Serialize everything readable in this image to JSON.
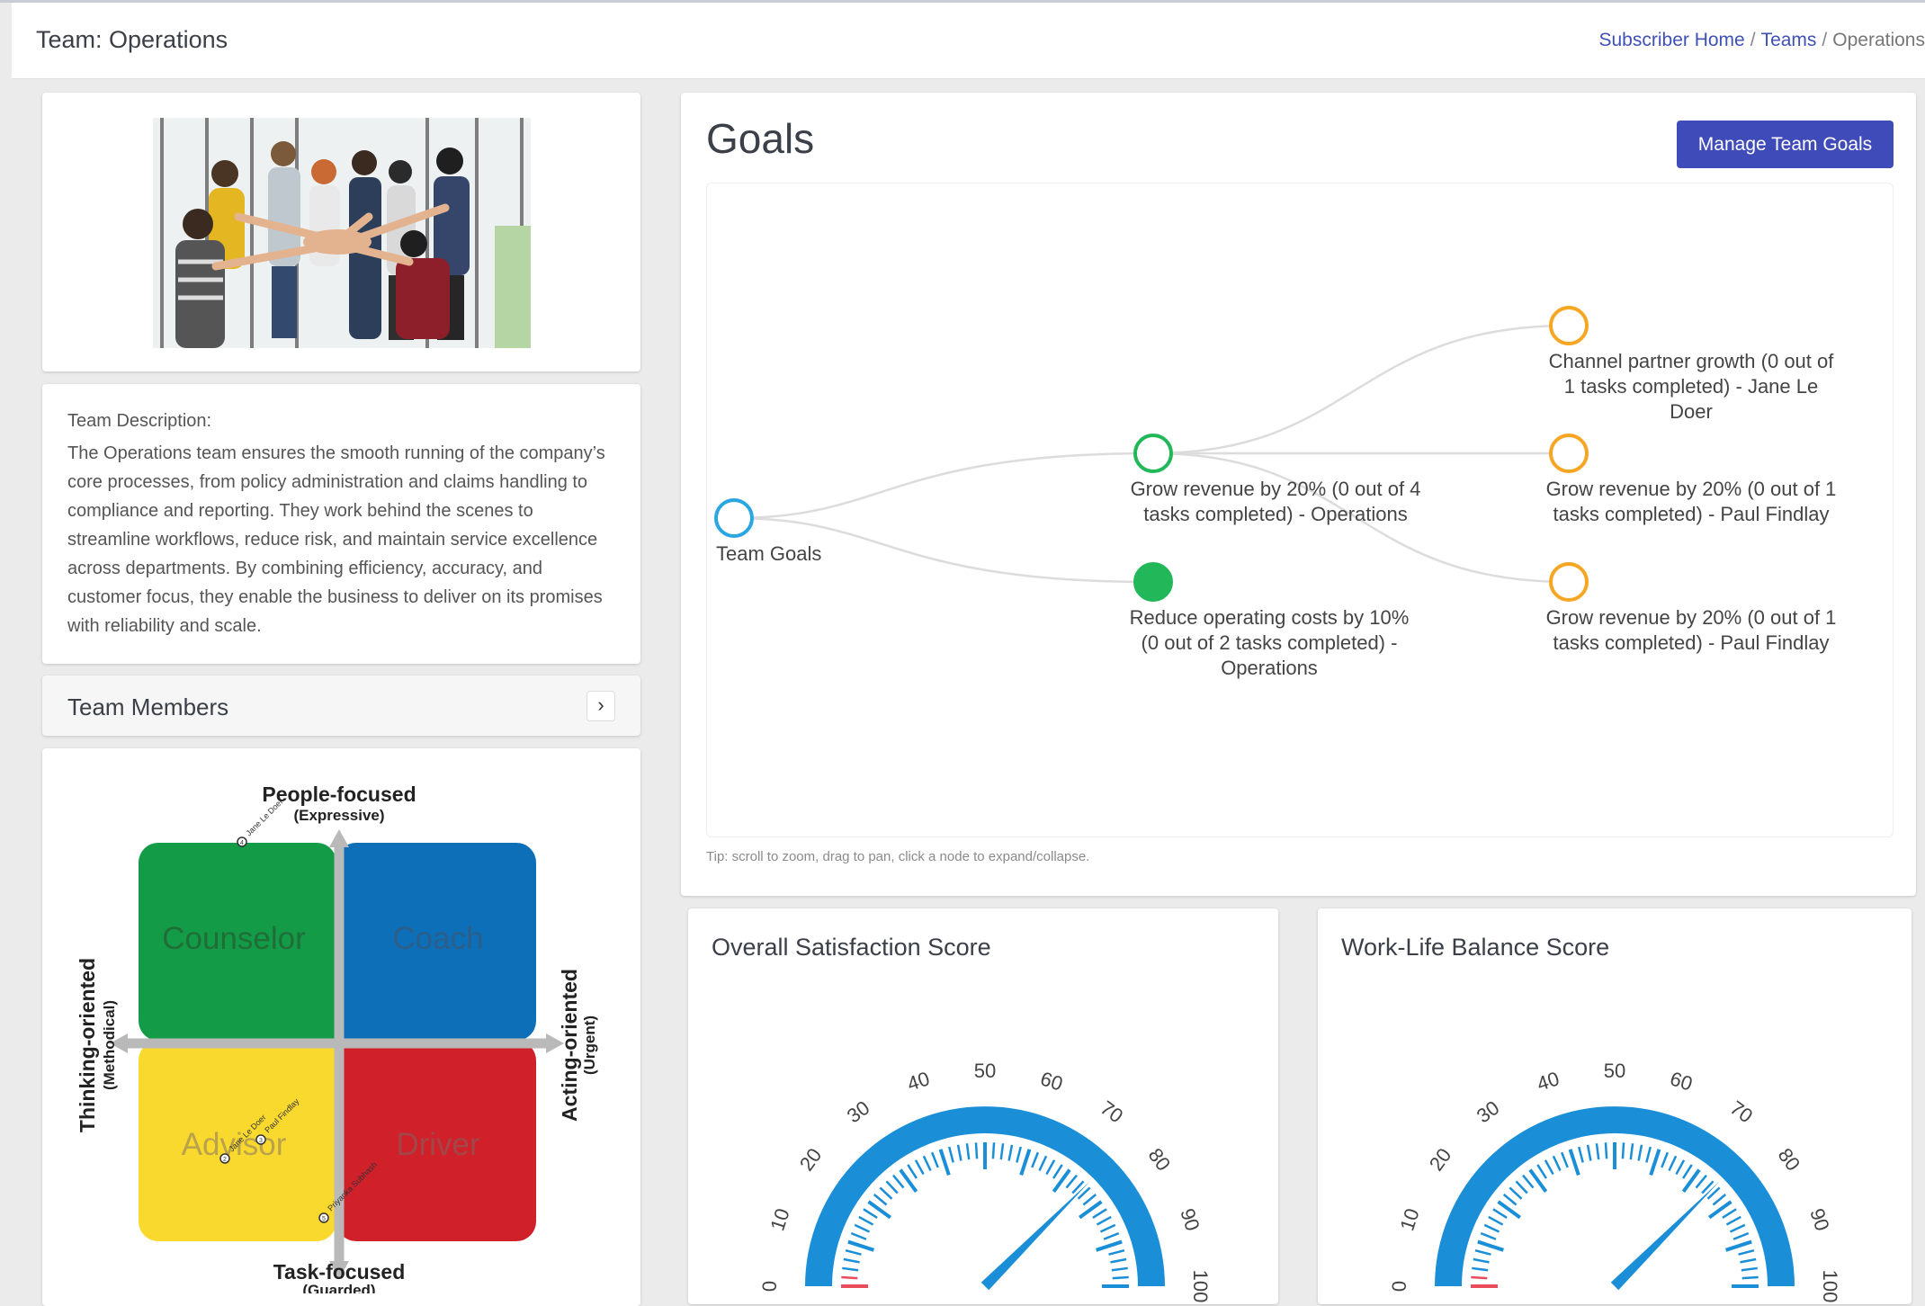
{
  "header": {
    "title": "Team: Operations",
    "breadcrumb": [
      "Subscriber Home",
      "Teams",
      "Operations"
    ]
  },
  "team": {
    "description_label": "Team Description:",
    "description": "The Operations team ensures the smooth running of the company’s core processes, from policy administration and claims handling to compliance and reporting. They work behind the scenes to streamline workflows, reduce risk, and maintain service excellence across departments. By combining efficiency, accuracy, and customer focus, they enable the business to deliver on its promises with reliability and scale.",
    "members_title": "Team Members",
    "members_toggle": "›"
  },
  "quadrant": {
    "top_label": "People-focused",
    "top_sub": "(Expressive)",
    "bottom_label": "Task-focused",
    "bottom_sub": "(Guarded)",
    "left_label": "Thinking-oriented",
    "left_sub": "(Methodical)",
    "right_label": "Acting-oriented",
    "right_sub": "(Urgent)",
    "quadrants": [
      "Counselor",
      "Coach",
      "Advisor",
      "Driver"
    ],
    "colors": {
      "counselor": "#149b47",
      "coach": "#0d6fb8",
      "advisor": "#f9d92e",
      "driver": "#d0202a"
    },
    "members": [
      {
        "name": "Jane Le Doer",
        "number": "4"
      },
      {
        "name": "Jane Le Doer",
        "number": "2"
      },
      {
        "name": "Paul Findlay",
        "number": "3"
      },
      {
        "name": "Priyanka Subhash",
        "number": "5"
      }
    ]
  },
  "goals": {
    "title": "Goals",
    "manage_button": "Manage Team Goals",
    "root": "Team Goals",
    "nodes": [
      {
        "lines": [
          "Grow revenue by 20% (0 out of 4",
          "tasks completed) - Operations"
        ],
        "status": "in-progress",
        "color": "#22b85a"
      },
      {
        "lines": [
          "Reduce operating costs by 10%",
          "(0 out of 2 tasks completed) -",
          "Operations"
        ],
        "status": "complete",
        "color": "#22b85a"
      },
      {
        "lines": [
          "Channel partner growth (0 out of",
          "1 tasks completed) - Jane Le",
          "Doer"
        ],
        "status": "pending",
        "color": "#f5a623"
      },
      {
        "lines": [
          "Grow revenue by 20% (0 out of 1",
          "tasks completed) - Paul Findlay"
        ],
        "status": "pending",
        "color": "#f5a623"
      },
      {
        "lines": [
          "Grow revenue by 20% (0 out of 1",
          "tasks completed) - Paul Findlay"
        ],
        "status": "pending",
        "color": "#f5a623"
      }
    ],
    "root_color": "#2aa7e0",
    "tip": "Tip: scroll to zoom, drag to pan, click a node to expand/collapse."
  },
  "gauges": [
    {
      "title": "Overall Satisfaction Score",
      "value": 75,
      "min": 0,
      "max": 100,
      "ticks": [
        "0",
        "10",
        "20",
        "30",
        "40",
        "50",
        "60",
        "70",
        "80",
        "90",
        "100"
      ]
    },
    {
      "title": "Work-Life Balance Score",
      "value": 75,
      "min": 0,
      "max": 100,
      "ticks": [
        "0",
        "10",
        "20",
        "30",
        "40",
        "50",
        "60",
        "70",
        "80",
        "90",
        "100"
      ]
    }
  ],
  "colors": {
    "accent": "#3f4bb8",
    "gauge": "#1a8fd8",
    "link": "#3f51b5"
  }
}
